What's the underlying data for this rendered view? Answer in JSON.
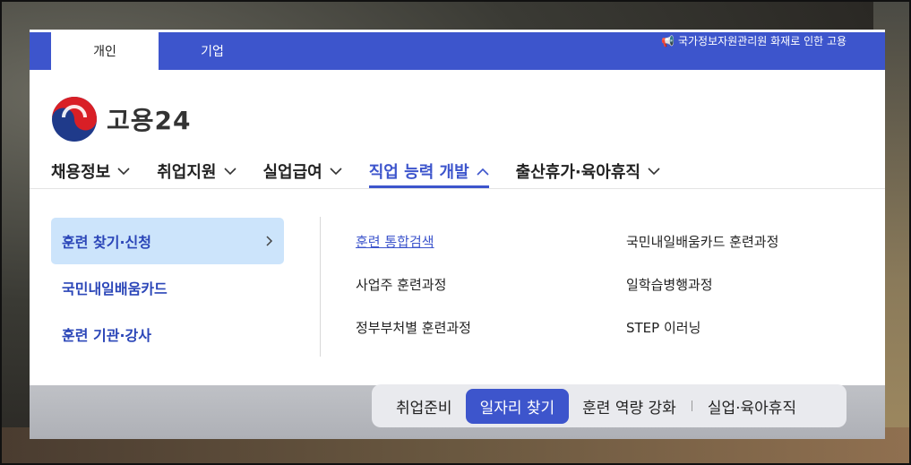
{
  "header": {
    "tabs": [
      {
        "label": "개인",
        "active": true
      },
      {
        "label": "기업",
        "active": false
      }
    ],
    "notice": "국가정보자원관리원 화재로 인한 고용"
  },
  "logo": {
    "text": "고용24"
  },
  "gnb": {
    "items": [
      {
        "label": "채용정보",
        "active": false
      },
      {
        "label": "취업지원",
        "active": false
      },
      {
        "label": "실업급여",
        "active": false
      },
      {
        "label": "직업 능력 개발",
        "active": true
      },
      {
        "label": "출산휴가·육아휴직",
        "active": false
      }
    ]
  },
  "submenu": {
    "side": [
      {
        "label": "훈련 찾기·신청",
        "active": true
      },
      {
        "label": "국민내일배움카드",
        "active": false
      },
      {
        "label": "훈련 기관·강사",
        "active": false
      }
    ],
    "links": [
      {
        "label": "훈련 통합검색",
        "active": true
      },
      {
        "label": "국민내일배움카드 훈련과정",
        "active": false
      },
      {
        "label": "사업주 훈련과정",
        "active": false
      },
      {
        "label": "일학습병행과정",
        "active": false
      },
      {
        "label": "정부부처별 훈련과정",
        "active": false
      },
      {
        "label": "STEP 이러닝",
        "active": false
      }
    ]
  },
  "quicknav": {
    "items": [
      "취업준비",
      "일자리 찾기",
      "훈련 역량 강화",
      "실업·육아휴직"
    ],
    "active_index": 1
  },
  "colors": {
    "brand_blue": "#3d55cc",
    "side_active_bg": "#cce4fb",
    "link_blue": "#2b46b8"
  }
}
